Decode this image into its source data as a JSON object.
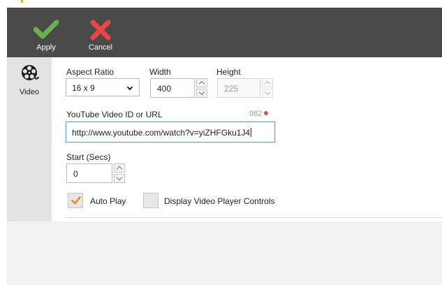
{
  "toolbar": {
    "apply_label": "Apply",
    "cancel_label": "Cancel",
    "icons": {
      "apply": "check-icon",
      "cancel": "close-x-icon"
    },
    "colors": {
      "background": "#4a4a4a",
      "apply": "#6ab04c",
      "cancel": "#e84545"
    }
  },
  "sidebar": {
    "items": [
      {
        "label": "Video",
        "icon": "film-reel-icon",
        "selected": true
      }
    ]
  },
  "form": {
    "aspect_ratio": {
      "label": "Aspect Ratio",
      "value": "16 x 9"
    },
    "width": {
      "label": "Width",
      "value": "400"
    },
    "height": {
      "label": "Height",
      "value": "225",
      "disabled": true
    },
    "youtube": {
      "label": "YouTube Video ID or URL",
      "value": "http://www.youtube.com/watch?v=yiZHFGku1J4",
      "counter": "982"
    },
    "start": {
      "label": "Start (Secs)",
      "value": "0"
    },
    "auto_play": {
      "label": "Auto Play",
      "checked": true
    },
    "display_controls": {
      "label": "Display Video Player Controls",
      "checked": false
    }
  }
}
